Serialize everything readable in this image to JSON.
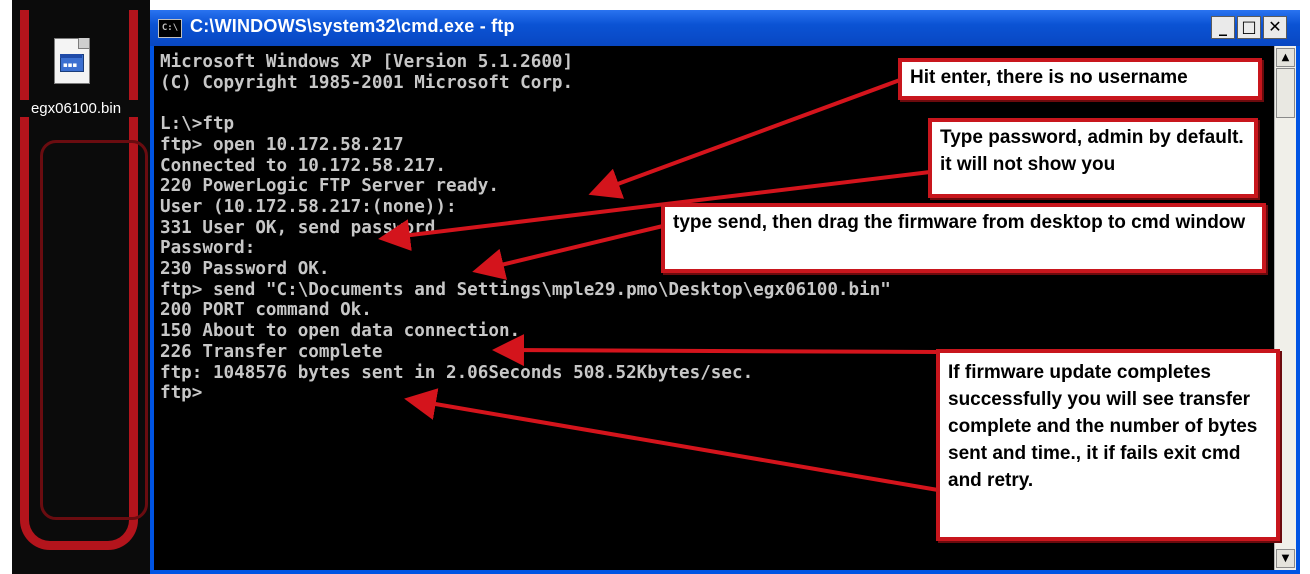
{
  "desktop": {
    "file_icon": "bin-file-icon",
    "file_label": "egx06100.bin"
  },
  "window": {
    "icon_label": "C:\\",
    "title": "C:\\WINDOWS\\system32\\cmd.exe - ftp",
    "minimize": "_",
    "maximize": "□",
    "close": "✕"
  },
  "console": {
    "lines": [
      "Microsoft Windows XP [Version 5.1.2600]",
      "(C) Copyright 1985-2001 Microsoft Corp.",
      "",
      "L:\\>ftp",
      "ftp> open 10.172.58.217",
      "Connected to 10.172.58.217.",
      "220 PowerLogic FTP Server ready.",
      "User (10.172.58.217:(none)):",
      "331 User OK, send password.",
      "Password:",
      "230 Password OK.",
      "ftp> send \"C:\\Documents and Settings\\mple29.pmo\\Desktop\\egx06100.bin\"",
      "200 PORT command Ok.",
      "150 About to open data connection.",
      "226 Transfer complete",
      "ftp: 1048576 bytes sent in 2.06Seconds 508.52Kbytes/sec.",
      "ftp>"
    ]
  },
  "scrollbar": {
    "up": "▲",
    "down": "▼"
  },
  "callouts": {
    "no_username": "Hit enter, there is no username",
    "password": "Type password, admin by default. it will not show you",
    "send": "type send, then drag the firmware from desktop to cmd window",
    "complete": "If firmware update completes successfully you will see transfer complete and the number of bytes sent and time., it if fails exit cmd and retry."
  },
  "colors": {
    "callout_border": "#c8161d",
    "arrow": "#d4141c",
    "console_bg": "#000000",
    "console_text": "#c7c7c7",
    "titlebar": "#0b53d4"
  }
}
